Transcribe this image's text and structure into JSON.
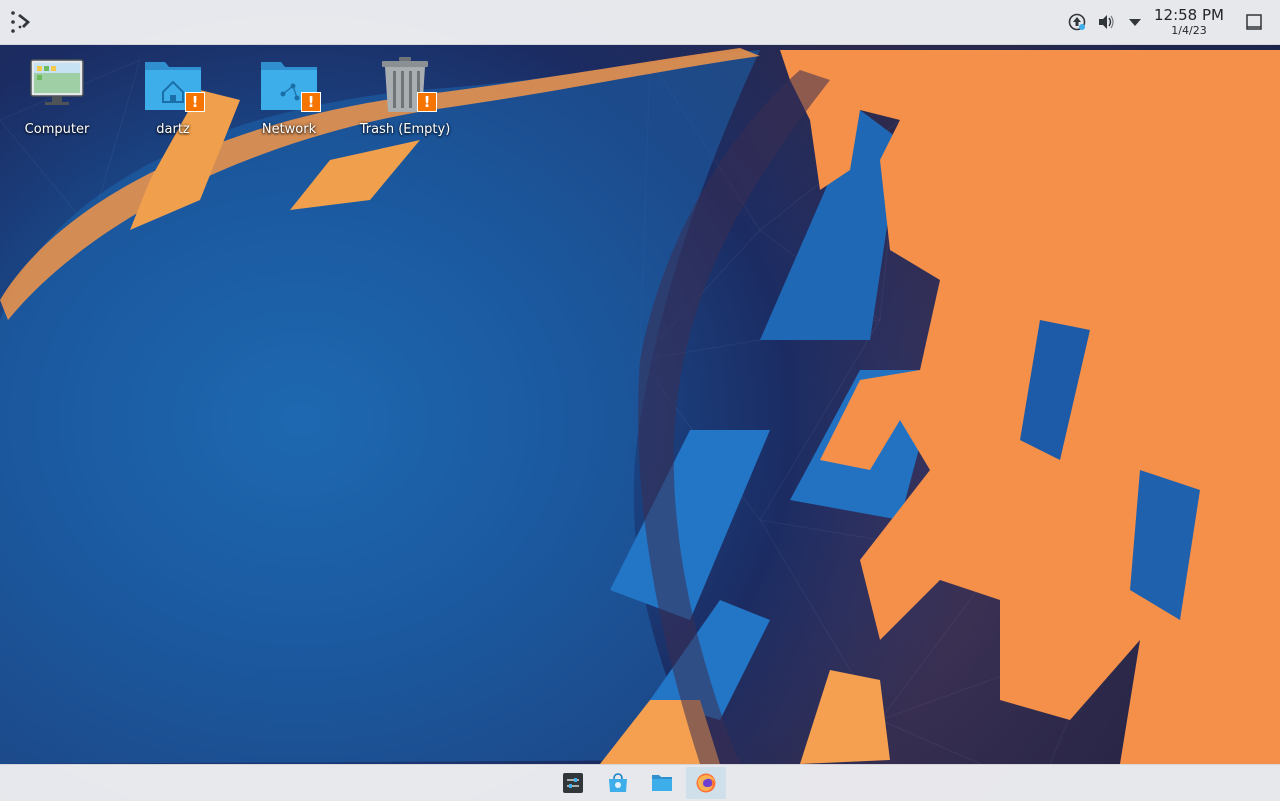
{
  "panel": {
    "launcher_icon": "kde-launcher-icon",
    "tray": {
      "updates_icon": "update-notifier-icon",
      "volume_icon": "volume-icon",
      "expand_icon": "tray-expand-arrow-icon",
      "show_desktop_icon": "show-desktop-icon"
    },
    "clock": {
      "time": "12:58 PM",
      "date": "1/4/23"
    }
  },
  "desktop": {
    "icons": [
      {
        "label": "Computer",
        "icon": "computer-icon",
        "warning": false
      },
      {
        "label": "dartz",
        "icon": "home-folder-icon",
        "warning": true
      },
      {
        "label": "Network",
        "icon": "network-folder-icon",
        "warning": true
      },
      {
        "label": "Trash (Empty)",
        "icon": "trash-icon",
        "warning": true
      }
    ],
    "warning_symbol": "!"
  },
  "taskbar": {
    "apps": [
      {
        "name": "system-settings",
        "icon": "settings-sliders-icon"
      },
      {
        "name": "discover",
        "icon": "software-store-icon"
      },
      {
        "name": "file-manager",
        "icon": "folder-icon"
      },
      {
        "name": "firefox",
        "icon": "firefox-icon",
        "active": true
      }
    ]
  },
  "colors": {
    "panel_bg": "#eff0f2",
    "accent_blue": "#3daee9",
    "warning_orange": "#f67400",
    "wallpaper_orange": "#f4904a",
    "wallpaper_blue": "#1d6cb8"
  }
}
